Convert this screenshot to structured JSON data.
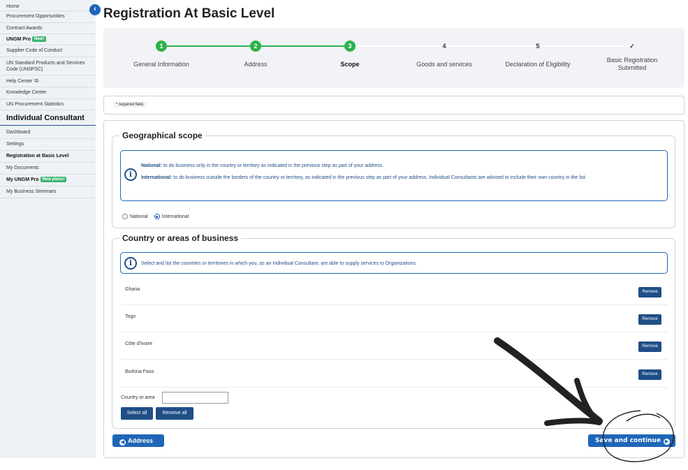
{
  "sidebar": {
    "collapse_icon": "chevron-left-icon",
    "items_top": [
      {
        "label": "Home"
      },
      {
        "label": "Procurement Opportunities"
      },
      {
        "label": "Contract Awards"
      },
      {
        "label": "UNGM Pro",
        "badge": "New!"
      },
      {
        "label": "Supplier Code of Conduct"
      },
      {
        "label": "UN Standard Products and Services Code (UNSPSC)"
      },
      {
        "label": "Help Center"
      },
      {
        "label": "Knowledge Center"
      },
      {
        "label": "UN Procurement Statistics"
      }
    ],
    "section_title": "Individual Consultant",
    "items_bottom": [
      {
        "label": "Dashboard"
      },
      {
        "label": "Settings"
      },
      {
        "label": "Registration at Basic Level"
      },
      {
        "label": "My Documents"
      },
      {
        "label": "My UNGM Pro",
        "badge": "New plans!"
      },
      {
        "label": "My Business Seminars"
      }
    ]
  },
  "page": {
    "title": "Registration At Basic Level"
  },
  "stepper": {
    "steps": [
      {
        "marker": "1",
        "label": "General Information",
        "state": "done"
      },
      {
        "marker": "2",
        "label": "Address",
        "state": "done"
      },
      {
        "marker": "3",
        "label": "Scope",
        "state": "current"
      },
      {
        "marker": "4",
        "label": "Goods and services",
        "state": "todo"
      },
      {
        "marker": "5",
        "label": "Declaration of Eligibility",
        "state": "todo"
      },
      {
        "marker": "✓",
        "label": "Basic Registration Submitted",
        "state": "todo"
      }
    ],
    "done_color": "#2db24c"
  },
  "required_note": "* required field.",
  "geo_scope": {
    "title": "Geographical scope",
    "national_label": "National:",
    "national_text": " to do business only in the country or territory as indicated in the previous step as part of your address.",
    "international_label": "International:",
    "international_text": " to do business outside the borders of the country or territory, as indicated in the previous step as part of your address. Individual Consultants are advised to include their own country in the list.",
    "radio_national": "National",
    "radio_international": "International",
    "selected": "International"
  },
  "countries_panel": {
    "title": "Country or areas of business",
    "info_text": "Select and list the countries or territories in which you, as an Individual Consultant, are able to supply services to Organizations.",
    "countries": [
      "Ghana",
      "Togo",
      "Côte d'Ivoire",
      "Burkina Faso"
    ],
    "remove_label": "Remove",
    "input_label": "Country or area",
    "input_value": "",
    "select_all_label": "Select all",
    "remove_all_label": "Remove all"
  },
  "nav": {
    "back_label": "Address",
    "back_icon": "arrow-left-circle-icon",
    "next_label": "Save and continue",
    "next_icon": "arrow-right-circle-icon"
  },
  "colors": {
    "primary": "#1f66b8",
    "dark_blue": "#1f4e87",
    "success": "#2db24c"
  }
}
